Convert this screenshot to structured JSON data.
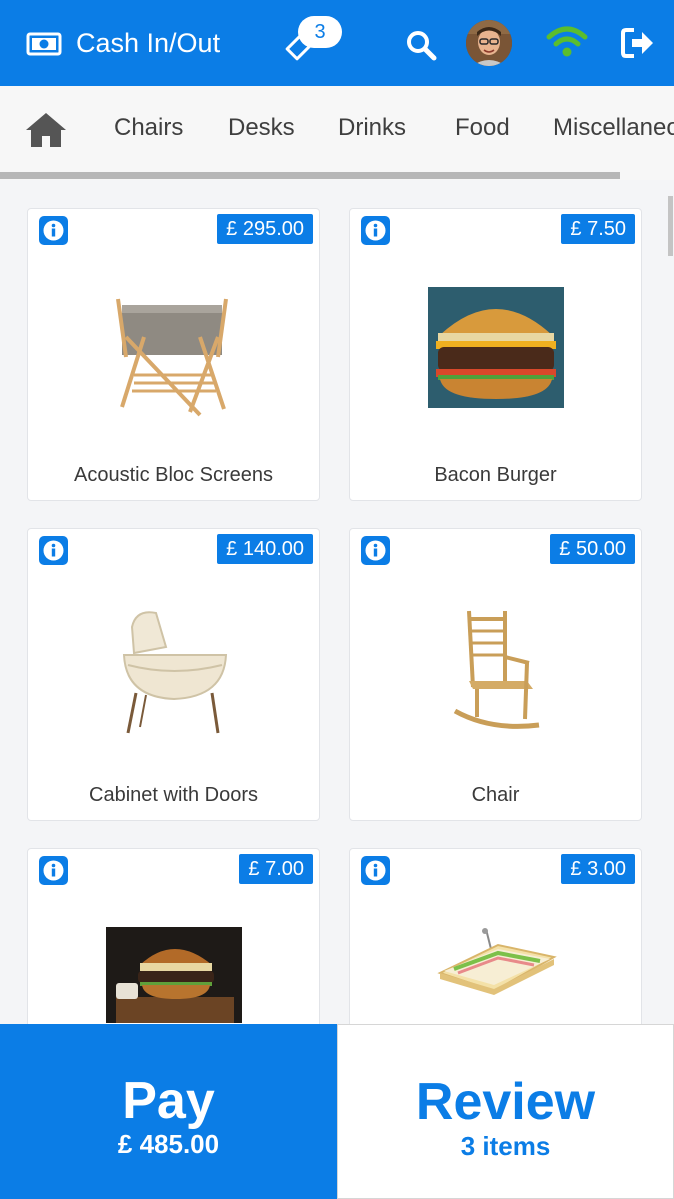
{
  "header": {
    "title": "Cash In/Out",
    "tag_badge": "3",
    "icons": [
      "cash-icon",
      "tag-icon",
      "search-icon",
      "avatar",
      "wifi-icon",
      "logout-icon"
    ]
  },
  "categories": [
    "Chairs",
    "Desks",
    "Drinks",
    "Food",
    "Miscellaneous"
  ],
  "products": [
    {
      "name": "Acoustic Bloc Screens",
      "price": "£ 295.00",
      "image": "crib-image"
    },
    {
      "name": "Bacon Burger",
      "price": "£ 7.50",
      "image": "burger-image"
    },
    {
      "name": "Cabinet with Doors",
      "price": "£ 140.00",
      "image": "bassinet-image"
    },
    {
      "name": "Chair",
      "price": "£ 50.00",
      "image": "rocking-chair-image"
    },
    {
      "name": "",
      "price": "£ 7.00",
      "image": "burger-board-image"
    },
    {
      "name": "",
      "price": "£ 3.00",
      "image": "sandwich-image"
    }
  ],
  "footer": {
    "pay_label": "Pay",
    "pay_amount": "£ 485.00",
    "review_label": "Review",
    "review_count": "3 items"
  },
  "colors": {
    "primary": "#0b7de6",
    "wifi": "#5bbd2e"
  }
}
